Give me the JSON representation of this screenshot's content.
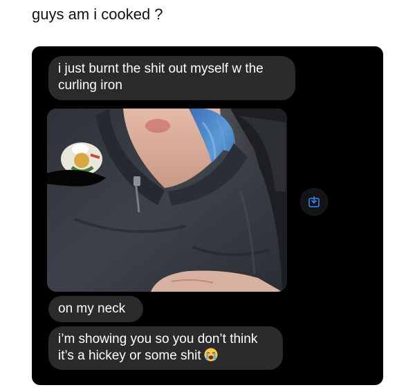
{
  "post": {
    "caption": "guys am i cooked ?"
  },
  "chat": {
    "messages": [
      {
        "lines": [
          "i just burnt the shit out myself w the",
          "curling iron"
        ]
      },
      {
        "type": "image"
      },
      {
        "lines": [
          "on my neck"
        ]
      },
      {
        "lines": [
          "i’m showing you so you don’t think",
          "it’s a hickey or some shit"
        ],
        "emoji": "loudly-crying-face-icon"
      }
    ],
    "save_button_icon": "save-to-device-icon"
  },
  "colors": {
    "chat_background": "#000000",
    "bubble_background": "#2b2b2e",
    "bubble_text": "#ffffff",
    "accent_blue": "#2f86f6"
  }
}
